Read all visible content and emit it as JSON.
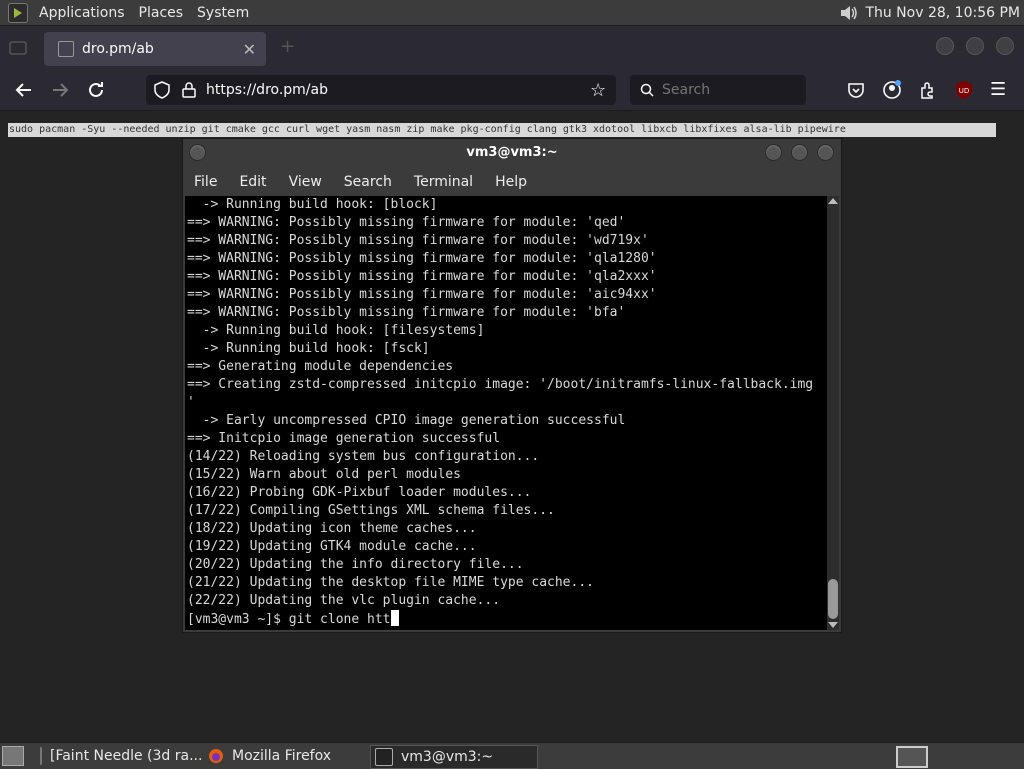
{
  "top_panel": {
    "menus": [
      "Applications",
      "Places",
      "System"
    ],
    "clock": "Thu Nov 28, 10:56 PM"
  },
  "browser": {
    "tab_title": "dro.pm/ab",
    "url": "https://dro.pm/ab",
    "search_placeholder": "Search",
    "selected_text": "sudo pacman -Syu --needed unzip git cmake gcc curl wget yasm nasm zip make pkg-config clang gtk3 xdotool libxcb libxfixes alsa-lib pipewire"
  },
  "terminal": {
    "title": "vm3@vm3:~",
    "menus": [
      "File",
      "Edit",
      "View",
      "Search",
      "Terminal",
      "Help"
    ],
    "lines": [
      "  -> Running build hook: [block]",
      "==> WARNING: Possibly missing firmware for module: 'qed'",
      "==> WARNING: Possibly missing firmware for module: 'wd719x'",
      "==> WARNING: Possibly missing firmware for module: 'qla1280'",
      "==> WARNING: Possibly missing firmware for module: 'qla2xxx'",
      "==> WARNING: Possibly missing firmware for module: 'aic94xx'",
      "==> WARNING: Possibly missing firmware for module: 'bfa'",
      "  -> Running build hook: [filesystems]",
      "  -> Running build hook: [fsck]",
      "==> Generating module dependencies",
      "==> Creating zstd-compressed initcpio image: '/boot/initramfs-linux-fallback.img",
      "'",
      "  -> Early uncompressed CPIO image generation successful",
      "==> Initcpio image generation successful",
      "(14/22) Reloading system bus configuration...",
      "(15/22) Warn about old perl modules",
      "(16/22) Probing GDK-Pixbuf loader modules...",
      "(17/22) Compiling GSettings XML schema files...",
      "(18/22) Updating icon theme caches...",
      "(19/22) Updating GTK4 module cache...",
      "(20/22) Updating the info directory file...",
      "(21/22) Updating the desktop file MIME type cache...",
      "(22/22) Updating the vlc plugin cache..."
    ],
    "prompt": "[vm3@vm3 ~]$ git clone htt"
  },
  "taskbar": {
    "items": [
      "[Faint Needle (3d ra...",
      "Mozilla Firefox",
      "vm3@vm3:~"
    ]
  }
}
